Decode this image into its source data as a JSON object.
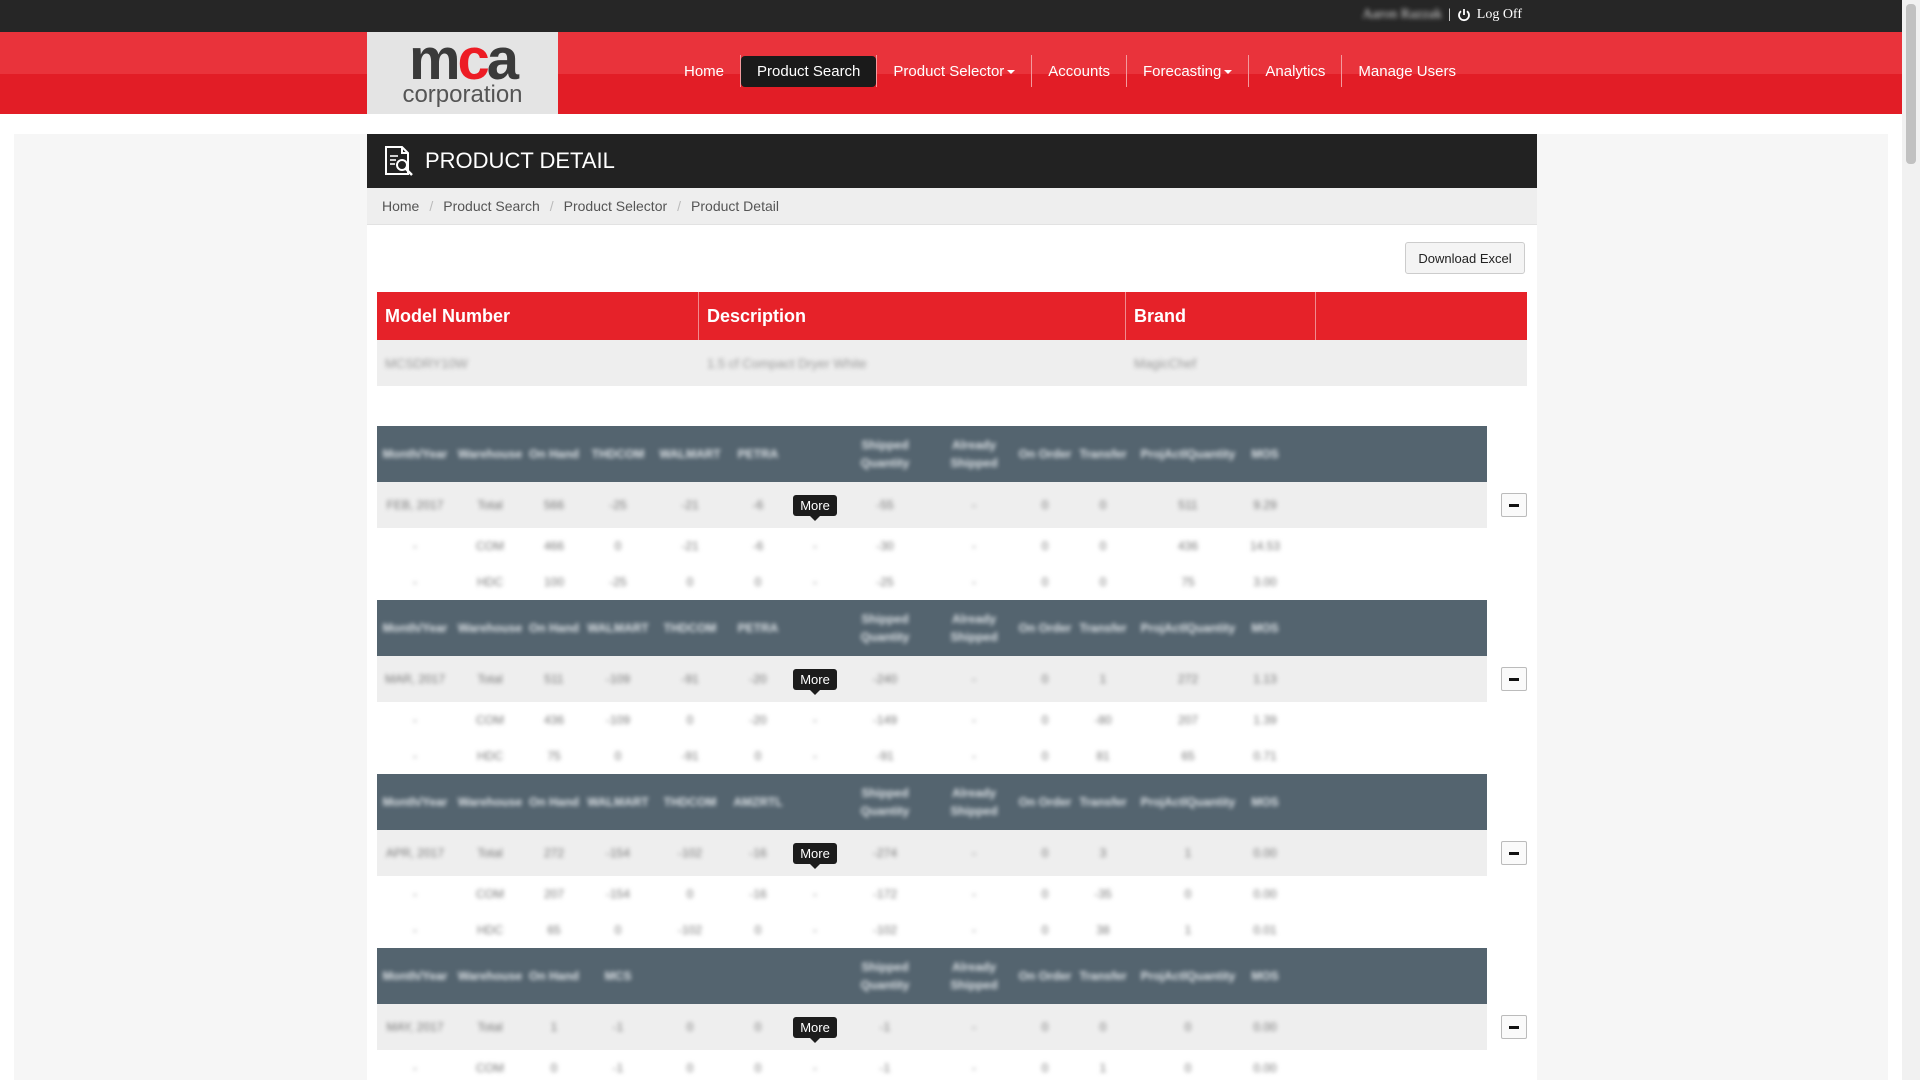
{
  "topbar": {
    "username": "Aaron Razzak",
    "separator": "|",
    "logoff_label": "Log Off"
  },
  "logo": {
    "top": "mca",
    "bottom": "corporation"
  },
  "nav": [
    {
      "label": "Home",
      "active": false,
      "dropdown": false
    },
    {
      "label": "Product Search",
      "active": true,
      "dropdown": false
    },
    {
      "label": "Product Selector",
      "active": false,
      "dropdown": true
    },
    {
      "label": "Accounts",
      "active": false,
      "dropdown": false
    },
    {
      "label": "Forecasting",
      "active": false,
      "dropdown": true
    },
    {
      "label": "Analytics",
      "active": false,
      "dropdown": false
    },
    {
      "label": "Manage Users",
      "active": false,
      "dropdown": false
    }
  ],
  "page": {
    "title": "PRODUCT DETAIL",
    "download_label": "Download Excel"
  },
  "breadcrumb": [
    "Home",
    "Product Search",
    "Product Selector",
    "Product Detail"
  ],
  "product": {
    "headers": [
      "Model Number",
      "Description",
      "Brand"
    ],
    "row": [
      "MCSDRY10W",
      "1.5 cf Compact Dryer White",
      "MagicChef"
    ]
  },
  "blocks": [
    {
      "headers": [
        "Month/Year",
        "Warehouse",
        "On Hand",
        "THDCOM",
        "WALMART",
        "PETRA",
        "",
        "Shipped Quantity",
        "Already Shipped",
        "On Order",
        "Transfer",
        "ProjActlQuantity",
        "MOS"
      ],
      "total": [
        "FEB, 2017",
        "Total",
        "566",
        "-25",
        "-21",
        "-6",
        "More",
        "-55",
        "-",
        "0",
        "0",
        "511",
        "9.29"
      ],
      "rows": [
        [
          "-",
          "COM",
          "466",
          "0",
          "-21",
          "-6",
          "-",
          "-30",
          "-",
          "0",
          "0",
          "436",
          "14.53"
        ],
        [
          "-",
          "HDC",
          "100",
          "-25",
          "0",
          "0",
          "-",
          "-25",
          "-",
          "0",
          "0",
          "75",
          "3.00"
        ]
      ]
    },
    {
      "headers": [
        "Month/Year",
        "Warehouse",
        "On Hand",
        "WALMART",
        "THDCOM",
        "PETRA",
        "",
        "Shipped Quantity",
        "Already Shipped",
        "On Order",
        "Transfer",
        "ProjActlQuantity",
        "MOS"
      ],
      "total": [
        "MAR, 2017",
        "Total",
        "511",
        "-109",
        "-91",
        "-20",
        "More",
        "-240",
        "-",
        "0",
        "1",
        "272",
        "1.13"
      ],
      "rows": [
        [
          "-",
          "COM",
          "436",
          "-109",
          "0",
          "-20",
          "-",
          "-149",
          "-",
          "0",
          "-80",
          "207",
          "1.39"
        ],
        [
          "-",
          "HDC",
          "75",
          "0",
          "-91",
          "0",
          "-",
          "-91",
          "-",
          "0",
          "81",
          "65",
          "0.71"
        ]
      ]
    },
    {
      "headers": [
        "Month/Year",
        "Warehouse",
        "On Hand",
        "WALMART",
        "THDCOM",
        "AMZRTL",
        "",
        "Shipped Quantity",
        "Already Shipped",
        "On Order",
        "Transfer",
        "ProjActlQuantity",
        "MOS"
      ],
      "total": [
        "APR, 2017",
        "Total",
        "272",
        "-154",
        "-102",
        "-16",
        "More",
        "-274",
        "-",
        "0",
        "3",
        "1",
        "0.00"
      ],
      "rows": [
        [
          "-",
          "COM",
          "207",
          "-154",
          "0",
          "-16",
          "-",
          "-172",
          "-",
          "0",
          "-35",
          "0",
          "0.00"
        ],
        [
          "-",
          "HDC",
          "65",
          "0",
          "-102",
          "0",
          "-",
          "-102",
          "-",
          "0",
          "38",
          "1",
          "0.01"
        ]
      ]
    },
    {
      "headers": [
        "Month/Year",
        "Warehouse",
        "On Hand",
        "MCS",
        "",
        "",
        "",
        "Shipped Quantity",
        "Already Shipped",
        "On Order",
        "Transfer",
        "ProjActlQuantity",
        "MOS"
      ],
      "total": [
        "MAY, 2017",
        "Total",
        "1",
        "-1",
        "0",
        "0",
        "More",
        "-1",
        "-",
        "0",
        "0",
        "0",
        "0.00"
      ],
      "rows": [
        [
          "-",
          "COM",
          "0",
          "-1",
          "0",
          "0",
          "-",
          "-1",
          "-",
          "0",
          "1",
          "0",
          "0.00"
        ]
      ]
    }
  ]
}
